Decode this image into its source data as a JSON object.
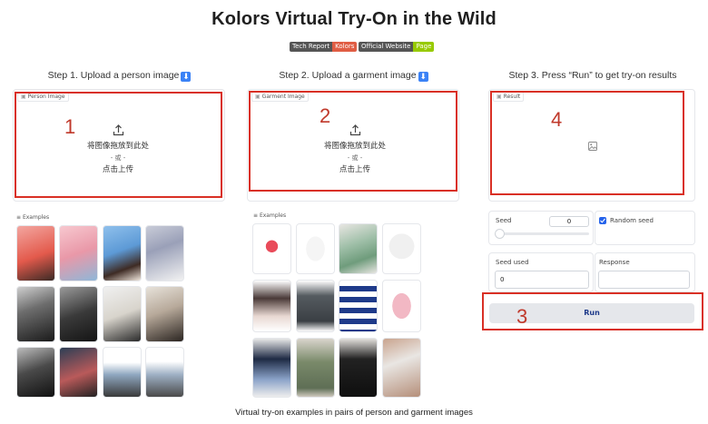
{
  "title": "Kolors Virtual Try-On in the Wild",
  "badges": [
    {
      "left": "Tech Report",
      "right": "Kolors",
      "right_color": "#e05d44"
    },
    {
      "left": "Official Website",
      "right": "Page",
      "right_color": "#97ca00"
    }
  ],
  "steps": {
    "step1": "Step 1. Upload a person image",
    "step2": "Step 2. Upload a garment image",
    "step3": "Step 3. Press “Run” to get try-on results"
  },
  "person_panel": {
    "label": "Person Image",
    "number": "1",
    "drop_text": "将图像拖放到此处",
    "or_text": "- 或 -",
    "click_text": "点击上传"
  },
  "garment_panel": {
    "label": "Garment Image",
    "number": "2",
    "drop_text": "将图像拖放到此处",
    "or_text": "- 或 -",
    "click_text": "点击上传"
  },
  "result_panel": {
    "label": "Result",
    "number": "4"
  },
  "examples_label": "Examples",
  "seed": {
    "label": "Seed",
    "value": "0"
  },
  "random_seed": {
    "label": "Random seed",
    "checked": true
  },
  "seed_used": {
    "label": "Seed used",
    "value": "0"
  },
  "response": {
    "label": "Response",
    "value": ""
  },
  "run": {
    "label": "Run",
    "number": "3"
  },
  "caption": "Virtual try-on examples in pairs of person and garment images",
  "colors": {
    "highlight": "#d93025",
    "accent": "#3b82f6"
  }
}
